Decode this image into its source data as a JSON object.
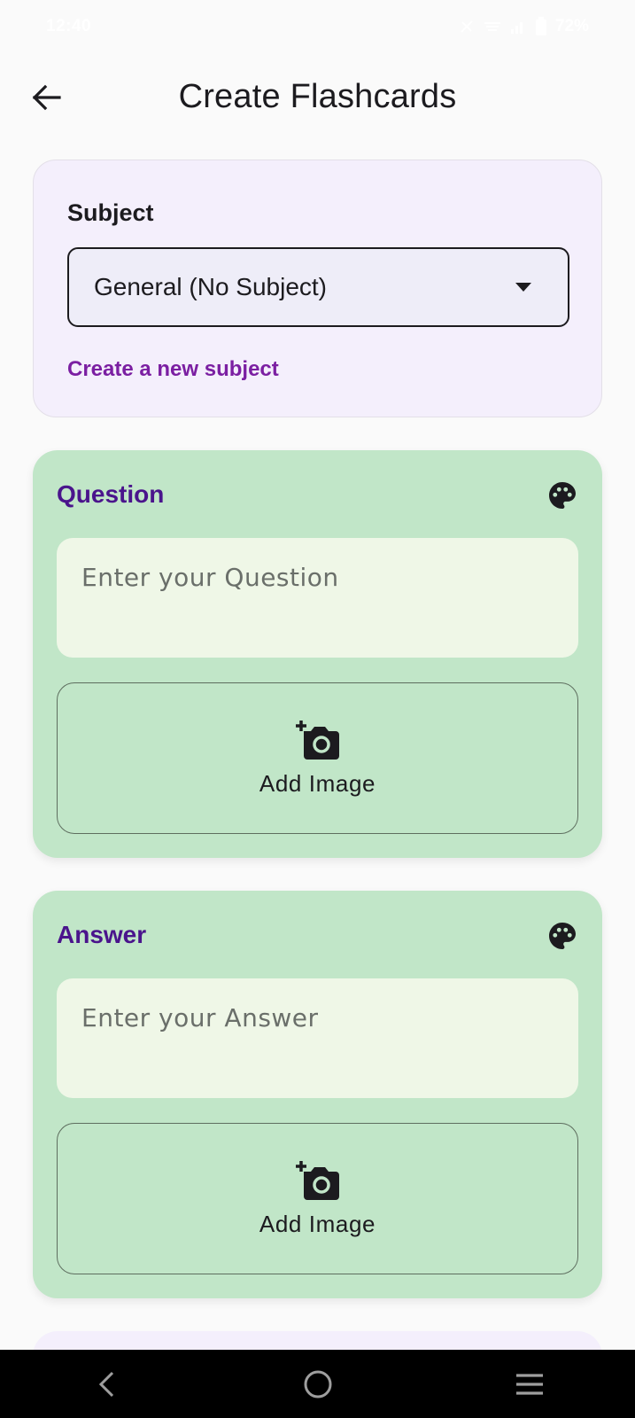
{
  "status_bar": {
    "time": "12:40",
    "battery": "72%"
  },
  "app_bar": {
    "title": "Create Flashcards",
    "back_icon": "arrow-back-icon"
  },
  "subject_section": {
    "label": "Subject",
    "selected_value": "General (No Subject)",
    "dropdown_icon": "dropdown-arrow-icon",
    "create_link": "Create a new subject"
  },
  "question_card": {
    "title": "Question",
    "placeholder": "Enter your Question",
    "value": "",
    "palette_icon": "palette-icon",
    "add_image_label": "Add Image",
    "add_image_icon": "add-photo-icon"
  },
  "answer_card": {
    "title": "Answer",
    "placeholder": "Enter your Answer",
    "value": "",
    "palette_icon": "palette-icon",
    "add_image_label": "Add Image",
    "add_image_icon": "add-photo-icon"
  },
  "nav_bar": {
    "back_icon": "nav-back-icon",
    "home_icon": "nav-home-icon",
    "recents_icon": "nav-recents-icon"
  },
  "colors": {
    "background": "#fafafa",
    "subject_card": "#f4effc",
    "side_card": "#c1e6c8",
    "text_field": "#eff7e7",
    "side_title": "#4a148c",
    "link": "#7b1fa2"
  }
}
